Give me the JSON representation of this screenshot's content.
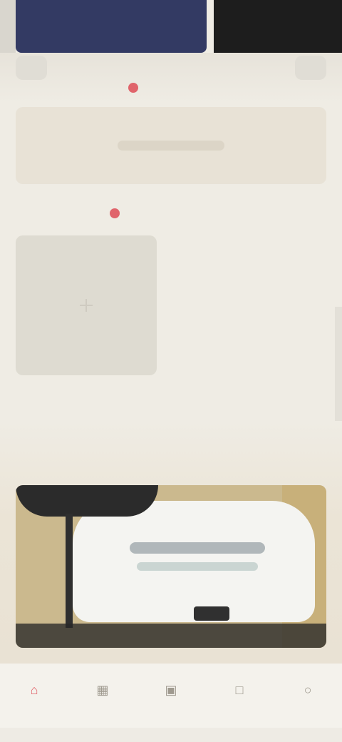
{
  "banner": {
    "left_color": "#333a63",
    "right_color": "#1d1d1d"
  },
  "sections": {
    "promo": {
      "title": "",
      "badge": ""
    },
    "products": {
      "title": "",
      "badge": ""
    },
    "featured": {
      "title": ""
    }
  },
  "hero": {
    "caption": ""
  },
  "colors": {
    "background": "#efece4",
    "accent": "#e0646b",
    "card": "#e8e2d6",
    "tile": "#dedbd1"
  },
  "tabs": [
    {
      "icon": "home-icon",
      "label": "",
      "active": true
    },
    {
      "icon": "category-icon",
      "label": "",
      "active": false
    },
    {
      "icon": "cart-icon",
      "label": "",
      "active": false
    },
    {
      "icon": "message-icon",
      "label": "",
      "active": false
    },
    {
      "icon": "profile-icon",
      "label": "",
      "active": false
    }
  ]
}
